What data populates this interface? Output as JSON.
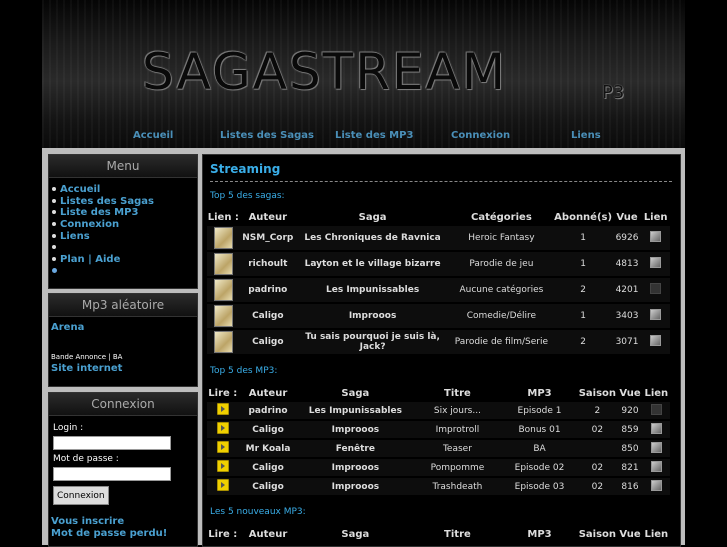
{
  "banner": {
    "logo": "SAGASTREAM",
    "logo_sub": "P3"
  },
  "topnav": [
    "Accueil",
    "Listes des Sagas",
    "Liste des MP3",
    "Connexion",
    "Liens"
  ],
  "menu": {
    "title": "Menu",
    "items": [
      "Accueil",
      "Listes des Sagas",
      "Liste des MP3",
      "Connexion",
      "Liens",
      "",
      "Plan | Aide",
      ""
    ]
  },
  "mp3box": {
    "title": "Mp3 aléatoire",
    "track": "Arena",
    "type": "Bande Annonce | BA",
    "site": "Site internet"
  },
  "login": {
    "title": "Connexion",
    "login_label": "Login :",
    "password_label": "Mot de passe :",
    "button": "Connexion",
    "register": "Vous inscrire",
    "forgot": "Mot de passe perdu!"
  },
  "main": {
    "title": "Streaming",
    "top_sagas_label": "Top 5 des sagas:",
    "sagas_headers": [
      "Lien :",
      "Auteur",
      "Saga",
      "Catégories",
      "Abonné(s)",
      "Vue",
      "Lien"
    ],
    "sagas": [
      {
        "author": "NSM_Corp",
        "saga": "Les Chroniques de Ravnica",
        "category": "Heroic Fantasy",
        "subs": "1",
        "views": "6926"
      },
      {
        "author": "richoult",
        "saga": "Layton et le village bizarre",
        "category": "Parodie de jeu",
        "subs": "1",
        "views": "4813"
      },
      {
        "author": "padrino",
        "saga": "Les Impunissables",
        "category": "Aucune catégories",
        "subs": "2",
        "views": "4201"
      },
      {
        "author": "Caligo",
        "saga": "Improoos",
        "category": "Comedie/Délire",
        "subs": "1",
        "views": "3403"
      },
      {
        "author": "Caligo",
        "saga": "Tu sais pourquoi je suis là, Jack?",
        "category": "Parodie de film/Serie",
        "subs": "2",
        "views": "3071"
      }
    ],
    "top_mp3_label": "Top 5 des MP3:",
    "mp3_headers": [
      "Lire :",
      "Auteur",
      "Saga",
      "Titre",
      "MP3",
      "Saison",
      "Vue",
      "Lien"
    ],
    "mp3s": [
      {
        "author": "padrino",
        "saga": "Les Impunissables",
        "title": "Six jours...",
        "mp3": "Episode 1",
        "season": "2",
        "views": "920"
      },
      {
        "author": "Caligo",
        "saga": "Improoos",
        "title": "Improtroll",
        "mp3": "Bonus 01",
        "season": "02",
        "views": "859"
      },
      {
        "author": "Mr Koala",
        "saga": "Fenêtre",
        "title": "Teaser",
        "mp3": "BA",
        "season": "",
        "views": "850"
      },
      {
        "author": "Caligo",
        "saga": "Improoos",
        "title": "Pompomme",
        "mp3": "Episode 02",
        "season": "02",
        "views": "821"
      },
      {
        "author": "Caligo",
        "saga": "Improoos",
        "title": "Trashdeath",
        "mp3": "Episode 03",
        "season": "02",
        "views": "816"
      }
    ],
    "new_mp3_label": "Les 5 nouveaux MP3:",
    "new_headers": [
      "Lire :",
      "Auteur",
      "Saga",
      "Titre",
      "MP3",
      "Saison",
      "Vue",
      "Lien"
    ]
  }
}
